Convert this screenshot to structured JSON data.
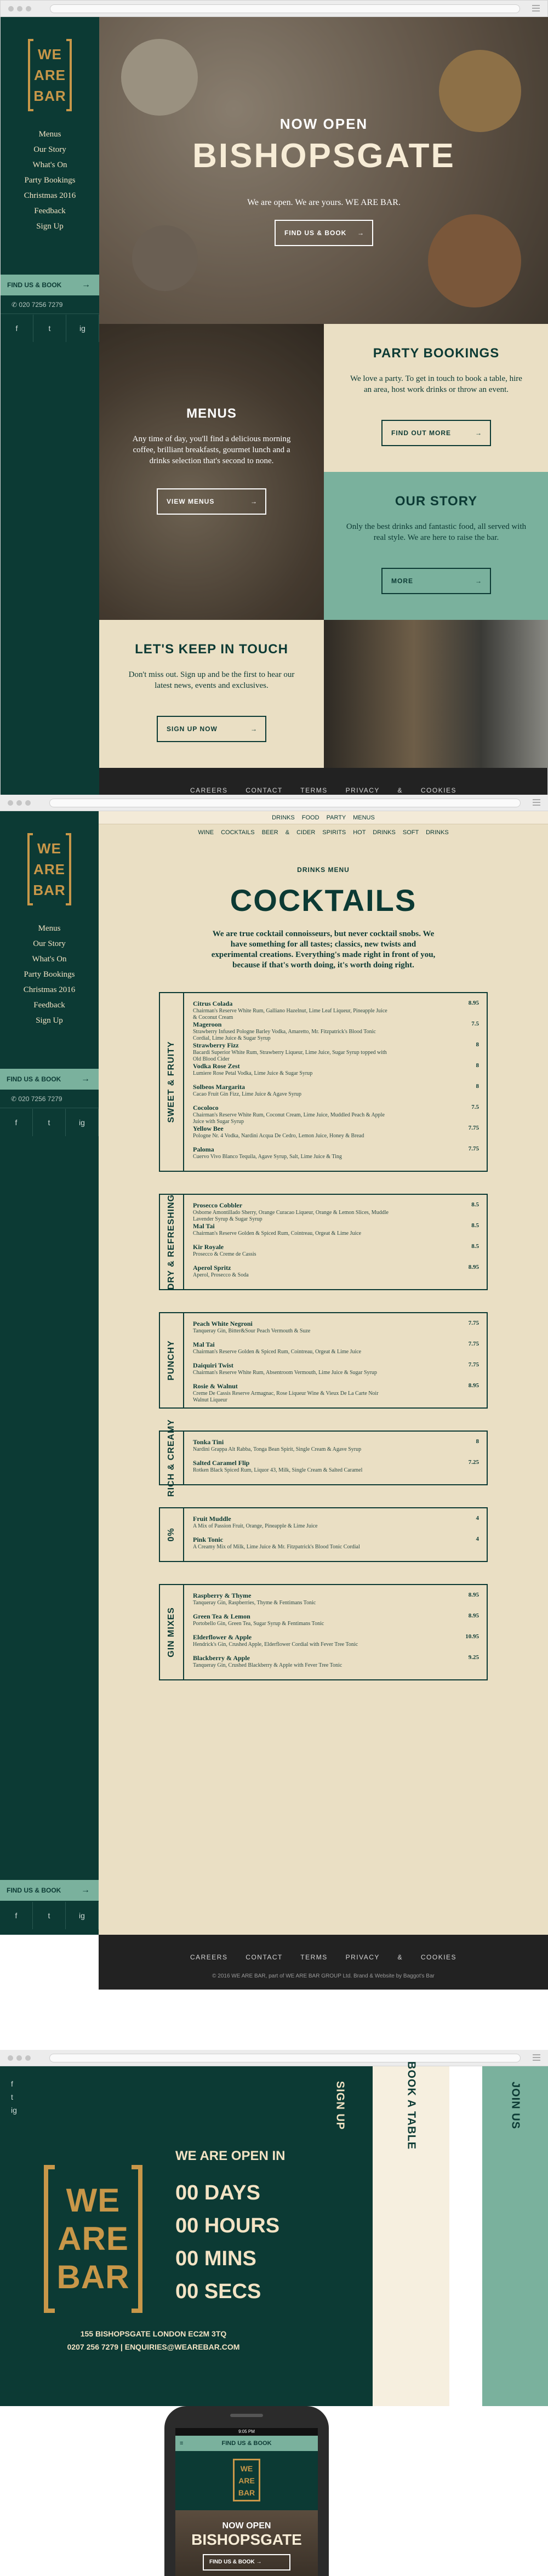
{
  "logo": {
    "line1": "WE",
    "line2": "ARE",
    "line3": "BAR"
  },
  "nav": [
    "Menus",
    "Our Story",
    "What's On",
    "Party Bookings",
    "Christmas 2016",
    "Feedback",
    "Sign Up"
  ],
  "sidebar": {
    "find_us": "FIND US & BOOK",
    "phone": "020 7256 7279",
    "social": [
      "f",
      "t",
      "ig"
    ]
  },
  "hero": {
    "now_open": "NOW OPEN",
    "title": "BISHOPSGATE",
    "tagline": "We are open. We are yours. WE ARE BAR.",
    "button": "FIND US & BOOK"
  },
  "tiles": {
    "party": {
      "title": "PARTY BOOKINGS",
      "text": "We love a party. To get in touch to book a table, hire an area, host work drinks or throw an event.",
      "button": "FIND OUT MORE"
    },
    "menus": {
      "title": "MENUS",
      "text": "Any time of day, you'll find a delicious morning coffee, brilliant breakfasts, gourmet lunch and a drinks selection that's second to none.",
      "button": "VIEW MENUS"
    },
    "story": {
      "title": "OUR STORY",
      "text": "Only the best drinks and fantastic food, all served with real style. We are here to raise the bar.",
      "button": "MORE"
    },
    "touch": {
      "title": "LET'S KEEP IN TOUCH",
      "text": "Don't miss out. Sign up and be the first to hear our latest news, events and exclusives.",
      "button": "SIGN UP NOW"
    }
  },
  "footer": {
    "links": "CAREERS CONTACT TERMS PRIVACY & COOKIES",
    "copy": "© 2016 WE ARE BAR, part of WE ARE BAR GROUP Ltd. Brand & Website by Baggot's Bar"
  },
  "menu_page": {
    "tabs": "DRINKS FOOD PARTY MENUS",
    "subtabs": "WINE COCKTAILS BEER & CIDER SPIRITS HOT DRINKS SOFT DRINKS",
    "label": "DRINKS MENU",
    "title": "COCKTAILS",
    "intro": "We are true cocktail connoisseurs, but never cocktail snobs. We have something for all tastes; classics, new twists and experimental creations. Everything's made right in front of you, because if that's worth doing, it's worth doing right.",
    "sections": [
      {
        "name": "SWEET & FRUITY",
        "items": [
          {
            "n": "Citrus Colada",
            "d": "Chairman's Reserve White Rum, Galliano Hazelnut, Lime Leaf Liqueur, Pineapple Juice & Coconut Cream",
            "p": "8.95"
          },
          {
            "n": "Mageroon",
            "d": "Strawberry Infused Pologne Barley Vodka, Amaretto, Mr. Fitzpatrick's Blood Tonic Cordial, Lime Juice & Sugar Syrup",
            "p": "7.5"
          },
          {
            "n": "Strawberry Fizz",
            "d": "Bacardi Superior White Rum, Strawberry Liqueur, Lime Juice, Sugar Syrup topped with Old Blood Cider",
            "p": "8"
          },
          {
            "n": "Vodka Rose Zest",
            "d": "Lumiere Rose Petal Vodka, Lime Juice & Sugar Syrup",
            "p": "8"
          },
          {
            "n": "Solbeos Margarita",
            "d": "Cacao Fruit Gin Fizz, Lime Juice & Agave Syrup",
            "p": "8"
          },
          {
            "n": "Cocoloco",
            "d": "Chairman's Reserve White Rum, Coconut Cream, Lime Juice, Muddled Peach & Apple Juice with Sugar Syrup",
            "p": "7.5"
          },
          {
            "n": "Yellow Bee",
            "d": "Pologne Nr. 4 Vodka, Nardini Acqua De Cedro, Lemon Juice, Honey & Bread",
            "p": "7.75"
          },
          {
            "n": "Paloma",
            "d": "Cuervo Vivo Blanco Tequila, Agave Syrup, Salt, Lime Juice & Ting",
            "p": "7.75"
          }
        ]
      },
      {
        "name": "DRY & REFRESHING",
        "items": [
          {
            "n": "Prosecco Cobbler",
            "d": "Osborne Amontillado Sherry, Orange Curacao Liqueur, Orange & Lemon Slices, Muddle Lavender Syrup & Sugar Syrup",
            "p": "8.5"
          },
          {
            "n": "Mal Tai",
            "d": "Chairman's Reserve Golden & Spiced Rum, Cointreau, Orgeat & Lime Juice",
            "p": "8.5"
          },
          {
            "n": "Kir Royale",
            "d": "Prosecco & Creme de Cassis",
            "p": "8.5"
          },
          {
            "n": "Aperol Spritz",
            "d": "Aperol, Prosecco & Soda",
            "p": "8.95"
          }
        ]
      },
      {
        "name": "PUNCHY",
        "items": [
          {
            "n": "Peach White Negroni",
            "d": "Tanqueray Gin, Bitter&Sour Peach Vermouth & Suze",
            "p": "7.75"
          },
          {
            "n": "Mal Tai",
            "d": "Chairman's Reserve Golden & Spiced Rum, Cointreau, Orgeat & Lime Juice",
            "p": "7.75"
          },
          {
            "n": "Daiquiri Twist",
            "d": "Chairman's Reserve White Rum, Absentroom Vermouth, Lime Juice & Sugar Syrup",
            "p": "7.75"
          },
          {
            "n": "Rosie & Walnut",
            "d": "Creme De Cassis Reserve Armagnac, Rose Liqueur Wine & Vieux De La Carte Noir Walnut Liqueur",
            "p": "8.95"
          }
        ]
      },
      {
        "name": "RICH & CREAMY",
        "items": [
          {
            "n": "Tonka Tini",
            "d": "Nardini Grappa Alt Rabba, Tonga Bean Spirit, Single Cream & Agave Syrup",
            "p": "8"
          },
          {
            "n": "Salted Caramel Flip",
            "d": "Rotken Black Spiced Rum, Liquor 43, Milk, Single Cream & Salted Caramel",
            "p": "7.25"
          }
        ]
      },
      {
        "name": "0%",
        "items": [
          {
            "n": "Fruit Muddle",
            "d": "A Mix of Passion Fruit, Orange, Pineapple & Lime Juice",
            "p": "4"
          },
          {
            "n": "Pink Tonic",
            "d": "A Creamy Mix of Milk, Lime Juice & Mr. Fitzpatrick's Blood Tonic Cordial",
            "p": "4"
          }
        ]
      },
      {
        "name": "GIN MIXES",
        "items": [
          {
            "n": "Raspberry & Thyme",
            "d": "Tanqueray Gin, Raspberries, Thyme & Fentimans Tonic",
            "p": "8.95"
          },
          {
            "n": "Green Tea & Lemon",
            "d": "Portobello Gin, Green Tea, Sugar Syrup & Fentimans Tonic",
            "p": "8.95"
          },
          {
            "n": "Elderflower & Apple",
            "d": "Hendrick's Gin, Crushed Apple, Elderflower Cordial with Fever Tree Tonic",
            "p": "10.95"
          },
          {
            "n": "Blackberry & Apple",
            "d": "Tanqueray Gin, Crushed Blackberry & Apple with Fever Tree Tonic",
            "p": "9.25"
          }
        ]
      }
    ]
  },
  "coming": {
    "heading": "WE ARE OPEN IN",
    "days": "00 DAYS",
    "hours": "00 HOURS",
    "mins": "00 MINS",
    "secs": "00 SECS",
    "address": "155 BISHOPSGATE LONDON EC2M 3TQ",
    "contact": "0207 256 7279 | ENQUIRIES@WEAREBAR.COM",
    "stripes": [
      "SIGN UP",
      "BOOK A TABLE",
      "JOIN US"
    ]
  },
  "mobile": {
    "time": "9:05 PM",
    "find": "FIND US & BOOK",
    "now_open": "NOW OPEN",
    "title": "BISHOPSGATE",
    "button": "FIND US & BOOK"
  }
}
